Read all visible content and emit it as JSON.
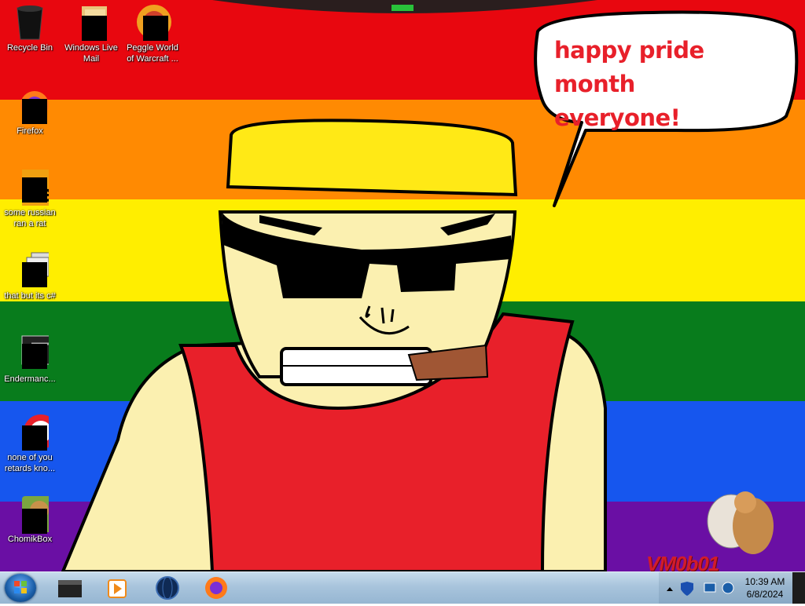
{
  "desktop": {
    "stripes": [
      "#e8070f",
      "#ff8a02",
      "#ffee00",
      "#087c1c",
      "#1656ee",
      "#6a0fa4"
    ],
    "icons": [
      {
        "label": "Recycle Bin",
        "icon": "recycle-bin-icon"
      },
      {
        "label": "Windows Live Mail",
        "icon": "mail-icon"
      },
      {
        "label": "Peggle World of Warcraft ...",
        "icon": "peggle-icon"
      },
      {
        "label": "Firefox",
        "icon": "firefox-icon"
      },
      {
        "label": "some russian ran a rat",
        "icon": "app-icon"
      },
      {
        "label": "that but its c#",
        "icon": "stacked-windows-icon"
      },
      {
        "label": "Endermanc...",
        "icon": "program-icon"
      },
      {
        "label": "none of you retards kno...",
        "icon": "red-circle-icon"
      },
      {
        "label": "ChomikBox",
        "icon": "hamster-icon"
      }
    ]
  },
  "wallpaper": {
    "speech_line1": "happy pride month",
    "speech_line2": "everyone!",
    "watermark": "VM0b01"
  },
  "taskbar": {
    "pinned": [
      "explorer-icon",
      "media-player-icon",
      "globe-icon",
      "firefox-icon"
    ]
  },
  "tray": {
    "time": "10:39 AM",
    "date": "6/8/2024",
    "icons": [
      "chevron-up-icon",
      "shield-icon",
      "network-icon",
      "volume-icon"
    ]
  }
}
